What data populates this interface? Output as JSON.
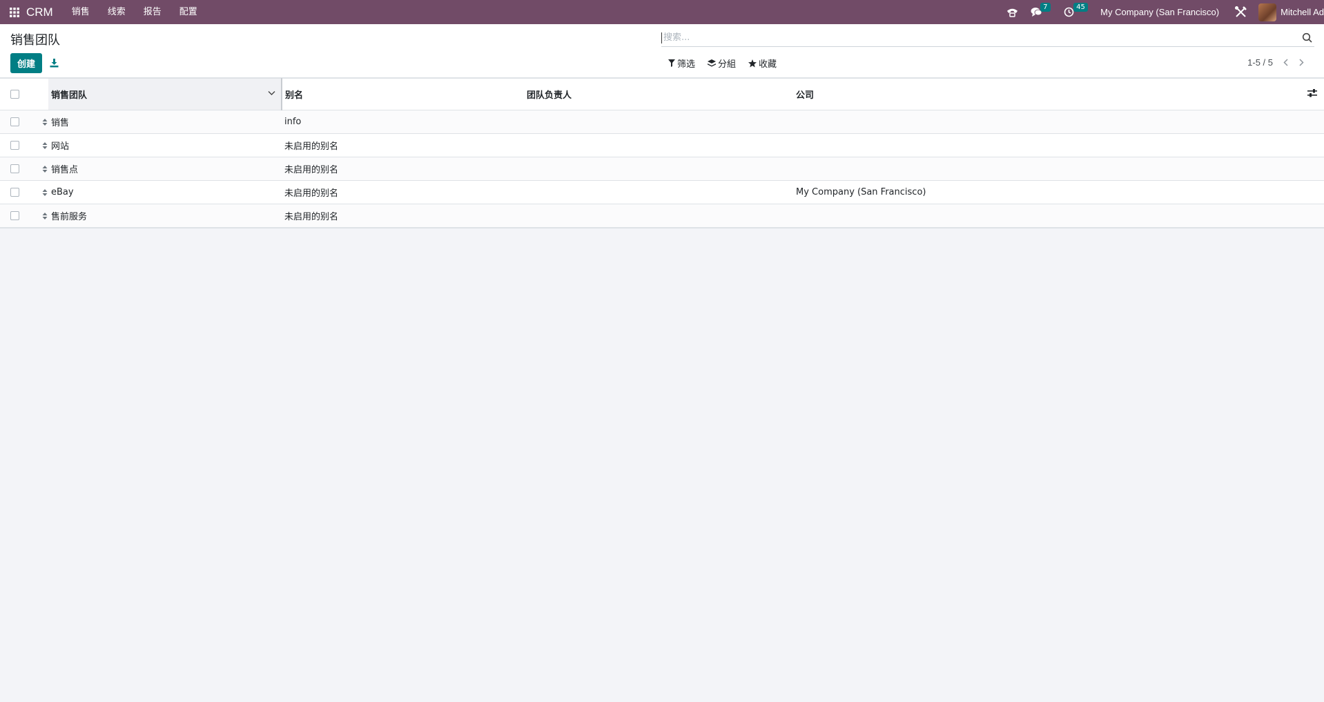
{
  "navbar": {
    "app_name": "CRM",
    "menu": [
      "销售",
      "线索",
      "报告",
      "配置"
    ],
    "messages_count": "7",
    "activities_count": "45",
    "company": "My Company (San Francisco)",
    "user": "Mitchell Ad",
    "icons": [
      "apps-icon",
      "phone-icon",
      "chat-icon",
      "clock-icon",
      "tools-icon"
    ]
  },
  "control_panel": {
    "title": "销售团队",
    "search_placeholder": "搜索...",
    "create_label": "创建",
    "filters_label": "筛选",
    "group_label": "分組",
    "favorites_label": "收藏",
    "pager": "1-5 / 5"
  },
  "table": {
    "columns": [
      "销售团队",
      "别名",
      "团队负责人",
      "公司"
    ],
    "rows": [
      {
        "team": "销售",
        "alias": "info",
        "leader": "",
        "company": ""
      },
      {
        "team": "网站",
        "alias": "未启用的别名",
        "leader": "",
        "company": ""
      },
      {
        "team": "销售点",
        "alias": "未启用的别名",
        "leader": "",
        "company": ""
      },
      {
        "team": "eBay",
        "alias": "未启用的别名",
        "leader": "",
        "company": "My Company (San Francisco)"
      },
      {
        "team": "售前服务",
        "alias": "未启用的别名",
        "leader": "",
        "company": ""
      }
    ]
  },
  "colors": {
    "navbar_bg": "#714b67",
    "primary": "#017e84",
    "badge": "#017e84",
    "page_bg": "#f3f4f8"
  }
}
